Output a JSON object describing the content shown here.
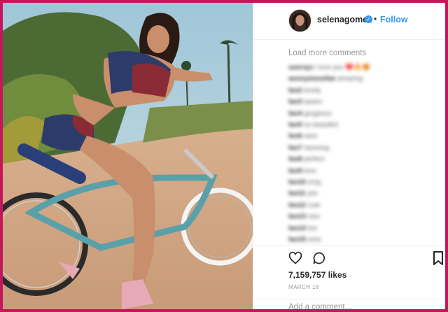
{
  "post": {
    "username": "selenagomez",
    "separator": "•",
    "follow_label": "Follow",
    "verified_badge_icon": "verified-check-icon",
    "load_more_label": "Load more comments",
    "likes_text": "7,159,757 likes",
    "date_text": "MARCH 18",
    "add_comment_placeholder": "Add a comment..."
  },
  "comments": [
    {
      "user": "userxyz",
      "text": "I love you ❤️🔥😍"
    },
    {
      "user": "anonymousfan",
      "text": "amazing"
    },
    {
      "user": "fan2",
      "text": "lovely"
    },
    {
      "user": "fan3",
      "text": "queen"
    },
    {
      "user": "fan4",
      "text": "gorgeous"
    },
    {
      "user": "fan5",
      "text": "so beautiful"
    },
    {
      "user": "fan6",
      "text": "wow"
    },
    {
      "user": "fan7",
      "text": "stunning"
    },
    {
      "user": "fan8",
      "text": "perfect"
    },
    {
      "user": "fan9",
      "text": "love"
    },
    {
      "user": "fan10",
      "text": "omg"
    },
    {
      "user": "fan11",
      "text": "yes"
    },
    {
      "user": "fan12",
      "text": "cute"
    },
    {
      "user": "fan13",
      "text": "nice"
    },
    {
      "user": "fan14",
      "text": "hot"
    },
    {
      "user": "fan15",
      "text": "wow"
    }
  ],
  "icons": {
    "like": "heart-icon",
    "comment": "comment-bubble-icon",
    "save": "bookmark-icon"
  },
  "colors": {
    "border_frame": "#c2185b",
    "follow_blue": "#3897f0",
    "text_dark": "#262626",
    "text_muted": "#999999"
  }
}
